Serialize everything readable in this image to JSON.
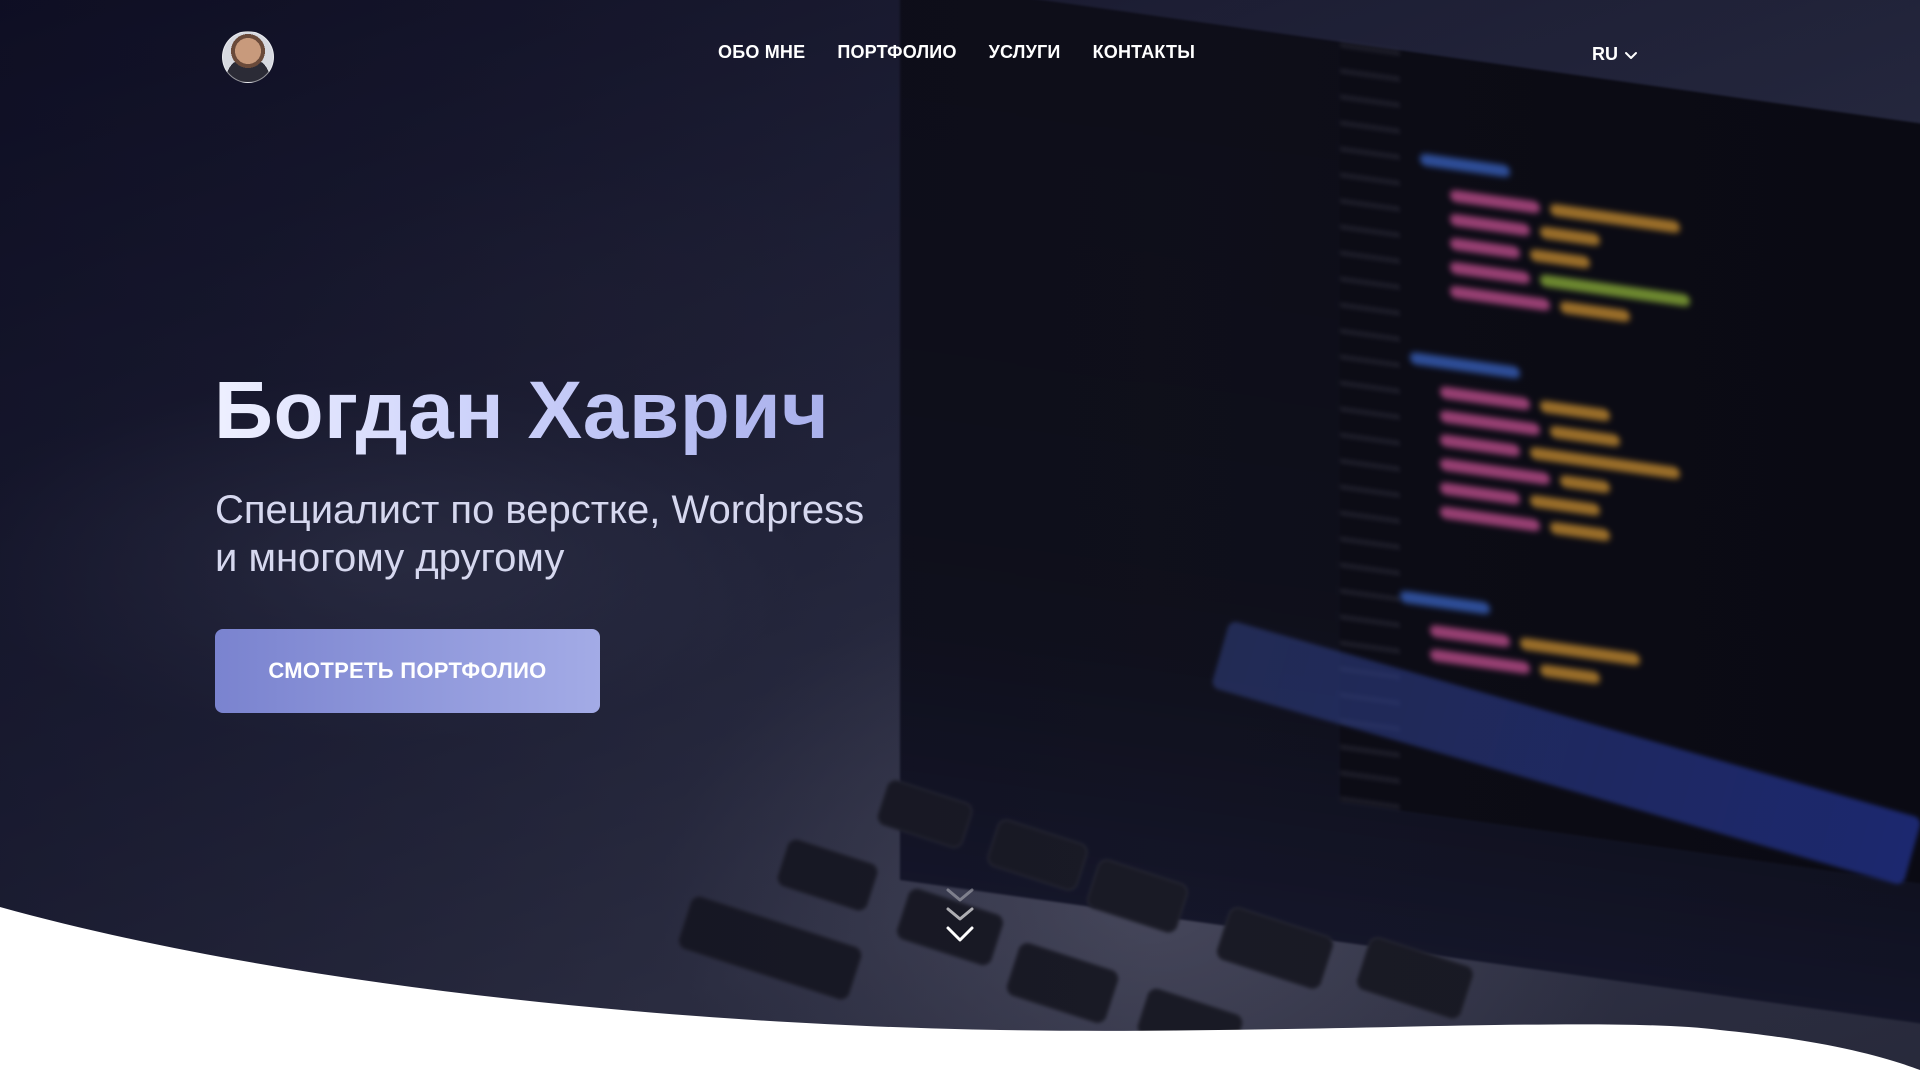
{
  "header": {
    "avatar_alt": "avatar",
    "nav": [
      {
        "label": "ОБО МНЕ"
      },
      {
        "label": "ПОРТФОЛИО"
      },
      {
        "label": "УСЛУГИ"
      },
      {
        "label": "КОНТАКТЫ"
      }
    ],
    "language": "RU"
  },
  "hero": {
    "title": "Богдан Хаврич",
    "subtitle_line1": "Специалист по верстке, Wordpress",
    "subtitle_line2": "и многому другому",
    "cta_label": "СМОТРЕТЬ ПОРТФОЛИО"
  },
  "icons": {
    "language_dropdown": "chevron-down-icon",
    "scroll_down": "triple-chevron-down-icon"
  },
  "colors": {
    "accent_start": "#7a83cf",
    "accent_end": "#a3abe6",
    "nav_text": "#ffffff",
    "title_gradient_end": "#a9b0ec"
  }
}
